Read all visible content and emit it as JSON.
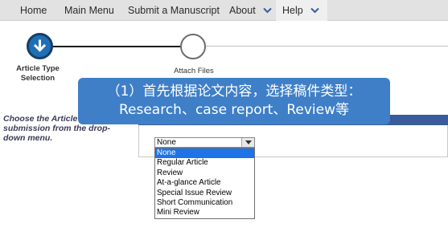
{
  "nav": {
    "home": "Home",
    "main_menu": "Main Menu",
    "submit": "Submit a Manuscript",
    "about": "About",
    "help": "Help"
  },
  "steps": {
    "active_label": "Article Type Selection",
    "next_label": "Attach Files"
  },
  "form": {
    "instruction": "Choose the Article your submission from the drop-down menu.",
    "select_value": "None",
    "options": [
      "None",
      "Regular Article",
      "Review",
      "At-a-glance Article",
      "Special Issue Review",
      "Short Communication",
      "Mini Review"
    ]
  },
  "overlay": {
    "line1": "（1）首先根据论文内容，选择稿件类型：",
    "line2": "Research、case report、Review等"
  },
  "colors": {
    "accent": "#1f6fb5",
    "header_bar": "#3a5b9c",
    "overlay": "#3f7fc8",
    "selected_option": "#1e73e8"
  },
  "icons": {
    "nav_chevron": "chevron-down-icon",
    "step_active": "arrow-down-icon"
  }
}
